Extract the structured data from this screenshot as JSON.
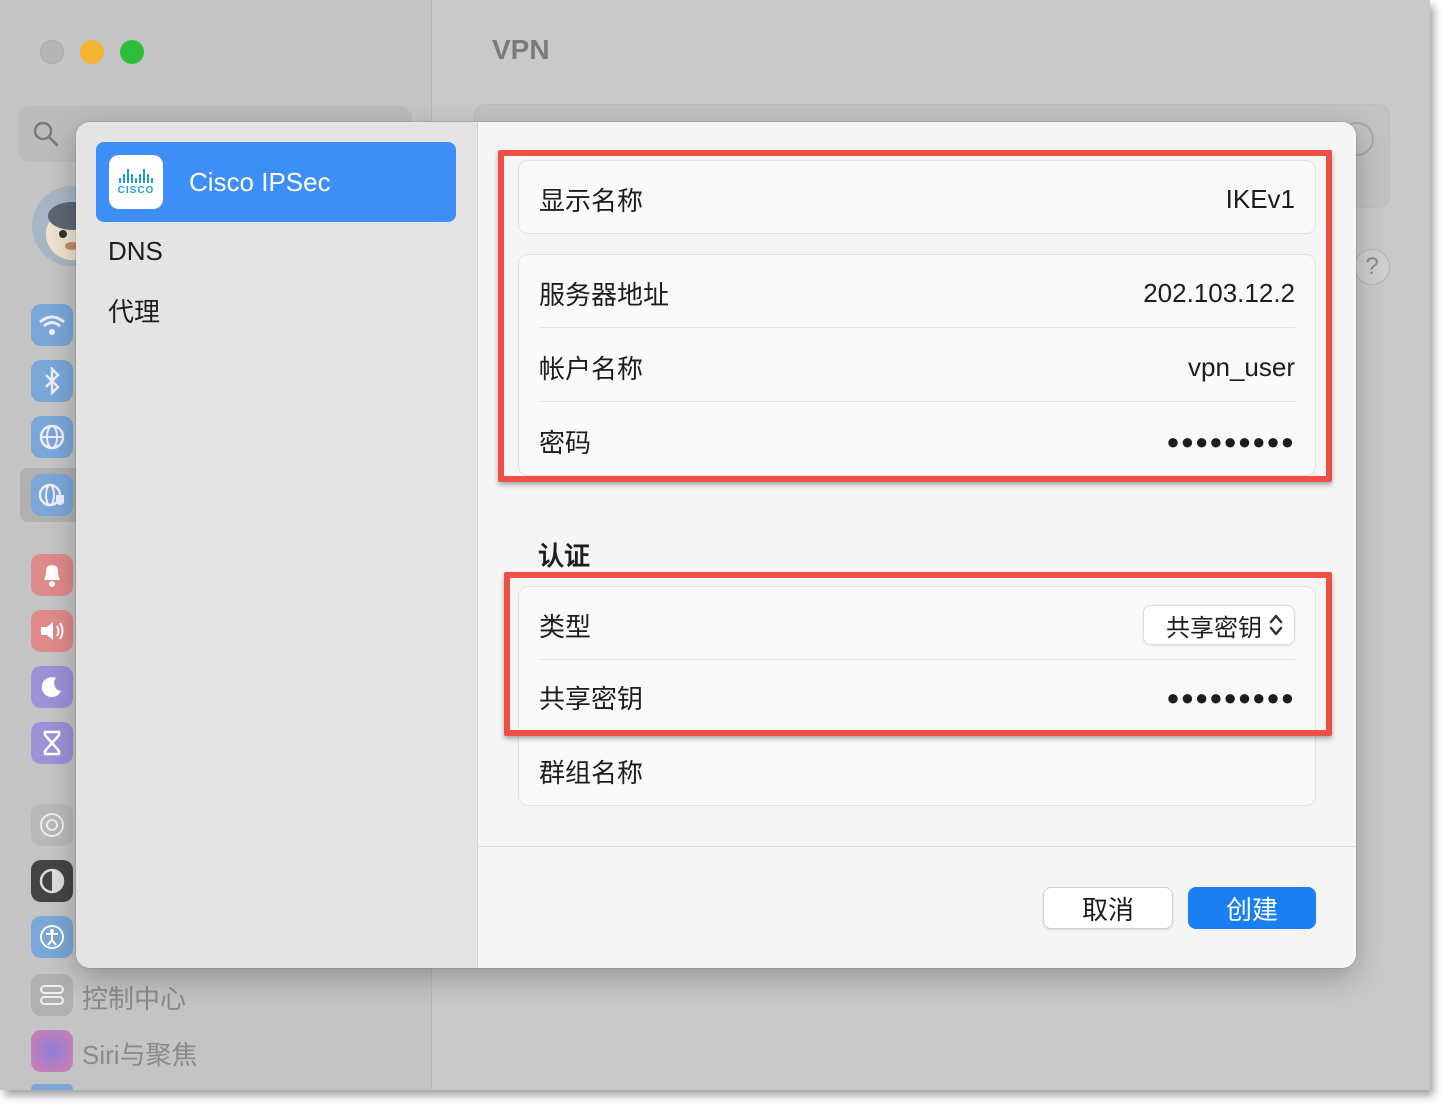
{
  "window": {
    "title": "VPN",
    "sidebar": {
      "search_placeholder": "",
      "items": [
        {
          "icon": "wifi-icon",
          "color": "#4a8fe0"
        },
        {
          "icon": "bluetooth-icon",
          "color": "#4a8fe0"
        },
        {
          "icon": "globe-icon",
          "color": "#4a8fe0"
        },
        {
          "icon": "vpn-globe-icon",
          "color": "#4a8fe0"
        },
        {
          "icon": "notifications-icon",
          "color": "#e25a5a"
        },
        {
          "icon": "sound-icon",
          "color": "#e25a5a"
        },
        {
          "icon": "focus-moon-icon",
          "color": "#6b5fd0"
        },
        {
          "icon": "screen-time-icon",
          "color": "#6b5fd0"
        },
        {
          "icon": "general-gear-icon",
          "color": "#9a9a9a"
        },
        {
          "icon": "appearance-icon",
          "color": "#333333"
        },
        {
          "icon": "accessibility-icon",
          "color": "#4a8fe0"
        }
      ],
      "bottom_items": [
        {
          "label": "控制中心",
          "icon": "control-center-icon"
        },
        {
          "label": "Siri与聚焦",
          "icon": "siri-icon"
        }
      ]
    },
    "help_label": "?"
  },
  "dialog": {
    "services": {
      "selected": {
        "label": "Cisco IPSec",
        "logo_text": "CISCO"
      },
      "items": [
        {
          "label": "DNS"
        },
        {
          "label": "代理"
        }
      ]
    },
    "fields": {
      "display_name": {
        "label": "显示名称",
        "value": "IKEv1"
      },
      "server_address": {
        "label": "服务器地址",
        "value": "202.103.12.2"
      },
      "account_name": {
        "label": "帐户名称",
        "value": "vpn_user"
      },
      "password": {
        "label": "密码",
        "value": "●●●●●●●●●"
      }
    },
    "auth": {
      "title": "认证",
      "type": {
        "label": "类型",
        "value": "共享密钥"
      },
      "shared_secret": {
        "label": "共享密钥",
        "value": "●●●●●●●●●"
      },
      "group_name": {
        "label": "群组名称",
        "value": ""
      }
    },
    "buttons": {
      "cancel": "取消",
      "create": "创建"
    }
  },
  "colors": {
    "accent": "#1a80f2",
    "selection": "#3d8ef7",
    "highlight": "#ee5048"
  }
}
